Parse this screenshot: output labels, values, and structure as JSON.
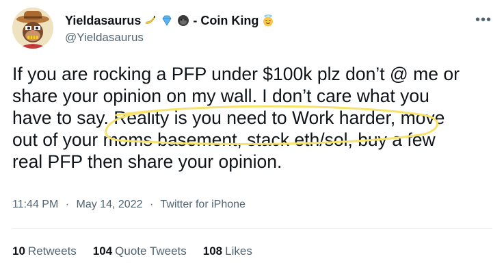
{
  "author": {
    "display_name": "Yieldasaurus",
    "name_suffix": "- Coin King",
    "handle": "@Yieldasaurus",
    "emojis": [
      "banana",
      "diamond",
      "gorilla",
      "angel"
    ]
  },
  "more_icon": "more-horizontal-icon",
  "tweet": {
    "lines": [
      "If you are rocking a PFP under $100k plz don’t @ me or",
      "share your opinion on my wall.  I don’t care what you",
      "have to say. Reality is you need to Work harder, move",
      "out of your moms basement, stack eth/sol, buy a few",
      "real PFP then share your opinion."
    ],
    "highlight_color": "#f7e36b"
  },
  "meta": {
    "time": "11:44 PM",
    "separator": "·",
    "date": "May 14, 2022",
    "source": "Twitter for iPhone"
  },
  "stats": {
    "retweets": {
      "count": "10",
      "label": "Retweets"
    },
    "quote_tweets": {
      "count": "104",
      "label": "Quote Tweets"
    },
    "likes": {
      "count": "108",
      "label": "Likes"
    }
  },
  "colors": {
    "text": "#0f1419",
    "secondary": "#536471",
    "divider": "#eff3f4"
  }
}
